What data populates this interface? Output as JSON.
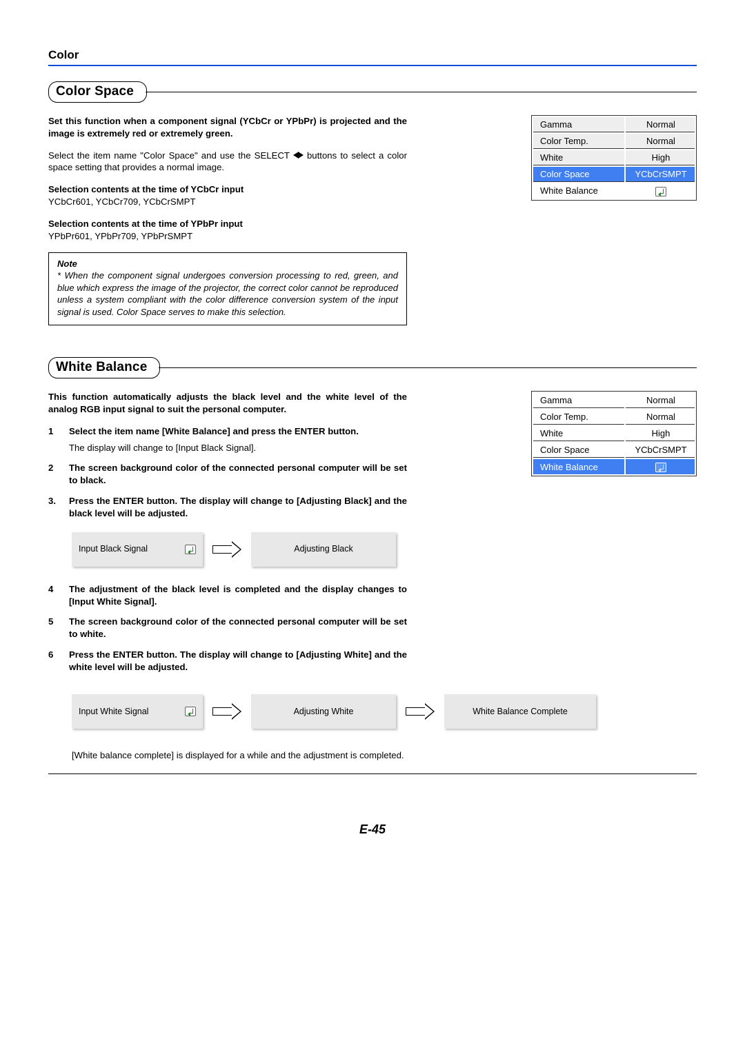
{
  "header": {
    "title": "Color"
  },
  "section1": {
    "title": "Color Space",
    "intro_bold": "Set this function when a component signal (YCbCr or YPbPr) is projected and the image is extremely red or extremely green.",
    "intro2a": "Select the item name \"Color Space\" and use the SELECT ",
    "intro2b": " buttons to select a color space setting that provides a normal image.",
    "sel1_title": "Selection contents at the time of YCbCr input",
    "sel1_body": "YCbCr601, YCbCr709, YCbCrSMPT",
    "sel2_title": "Selection contents at the time of YPbPr input",
    "sel2_body": "YPbPr601, YPbPr709, YPbPrSMPT",
    "note_label": "Note",
    "note_body": "* When the component signal undergoes conversion processing to red, green, and blue which express the image of the projector, the correct color cannot be reproduced unless a system compliant with the color difference conversion system of the input signal is used. Color Space serves to make this selection."
  },
  "menu1": [
    {
      "k": "Gamma",
      "v": "Normal",
      "cls": "light"
    },
    {
      "k": "Color Temp.",
      "v": "Normal",
      "cls": "light"
    },
    {
      "k": "White",
      "v": "High",
      "cls": "light"
    },
    {
      "k": "Color Space",
      "v": "YCbCrSMPT",
      "cls": "hi"
    },
    {
      "k": "White Balance",
      "v": "__icon",
      "cls": ""
    }
  ],
  "section2": {
    "title": "White Balance",
    "intro_bold": "This function automatically adjusts the black level and the white level of the analog RGB input signal to suit the personal computer.",
    "steps": [
      {
        "n": "1",
        "b": "Select the item name [White Balance] and press the ENTER button.",
        "s": "The display will change to [Input Black Signal]."
      },
      {
        "n": "2",
        "b": "The screen background color of the connected personal computer will be set to black."
      },
      {
        "n": "3.",
        "b": "Press the ENTER button. The display will change to [Adjusting Black] and the black level will be adjusted."
      }
    ],
    "box_input_black": "Input Black Signal",
    "box_adj_black": "Adjusting Black",
    "steps2": [
      {
        "n": "4",
        "b": "The adjustment of the black level is completed and the display changes to [Input White Signal]."
      },
      {
        "n": "5",
        "b": "The screen background color of the connected personal computer will be set to white."
      },
      {
        "n": "6",
        "b": "Press the ENTER button. The display will change to [Adjusting White] and the white level will be adjusted."
      }
    ],
    "box_input_white": "Input White Signal",
    "box_adj_white": "Adjusting White",
    "box_complete": "White Balance Complete",
    "closing": "[White balance complete] is displayed for a while and the adjustment is completed."
  },
  "menu2": [
    {
      "k": "Gamma",
      "v": "Normal",
      "cls": ""
    },
    {
      "k": "Color Temp.",
      "v": "Normal",
      "cls": ""
    },
    {
      "k": "White",
      "v": "High",
      "cls": ""
    },
    {
      "k": "Color Space",
      "v": "YCbCrSMPT",
      "cls": ""
    },
    {
      "k": "White Balance",
      "v": "__icon",
      "cls": "hi"
    }
  ],
  "page_number": "E-45"
}
